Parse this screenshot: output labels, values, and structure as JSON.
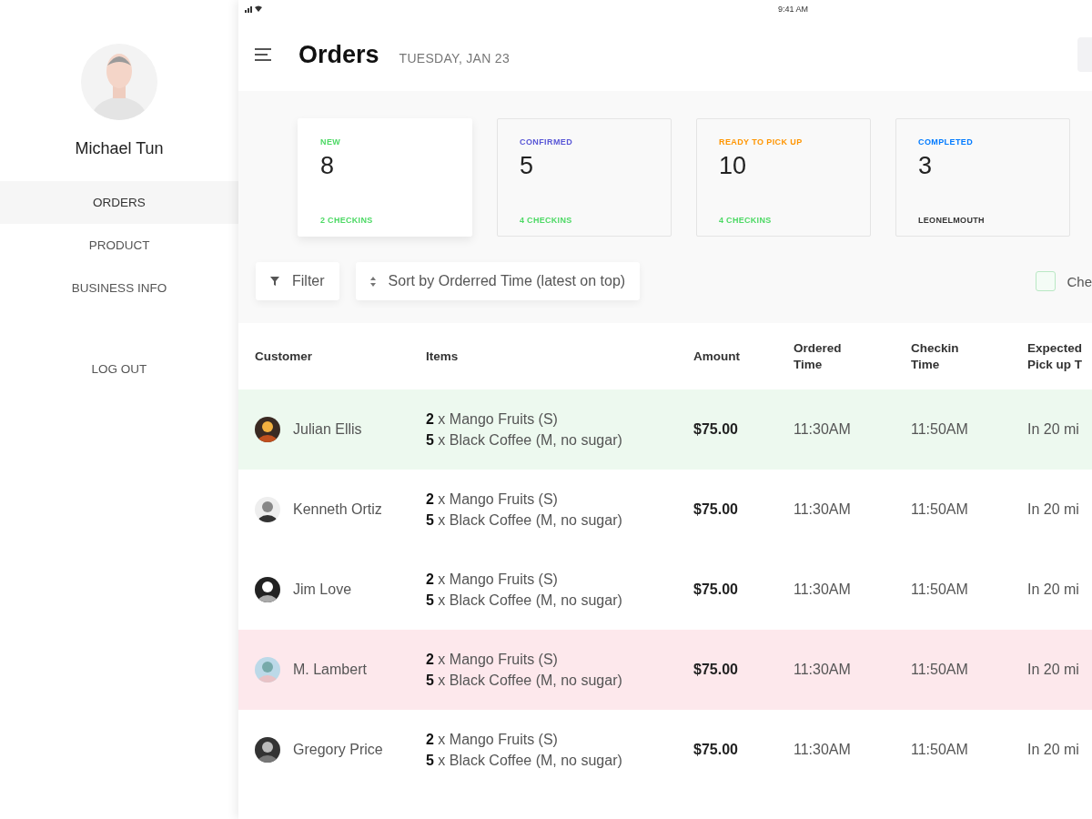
{
  "status_bar": {
    "time": "9:41 AM"
  },
  "sidebar": {
    "user_name": "Michael Tun",
    "items": [
      {
        "label": "ORDERS",
        "selected": true
      },
      {
        "label": "PRODUCT",
        "selected": false
      },
      {
        "label": "BUSINESS INFO",
        "selected": false
      }
    ],
    "logout": "LOG OUT"
  },
  "header": {
    "title": "Orders",
    "date": "TUESDAY, JAN 23"
  },
  "summary_cards": [
    {
      "label": "NEW",
      "count": "8",
      "footer": "2 CHECKINS",
      "kind": "checkins",
      "color": "#4cd964",
      "selected": true
    },
    {
      "label": "CONFIRMED",
      "count": "5",
      "footer": "4 CHECKINS",
      "kind": "checkins",
      "color": "#5856d6",
      "selected": false
    },
    {
      "label": "READY TO PICK UP",
      "count": "10",
      "footer": "4 CHECKINS",
      "kind": "checkins",
      "color": "#ff9500",
      "selected": false
    },
    {
      "label": "COMPLETED",
      "count": "3",
      "footer": "LEONELMOUTH",
      "kind": "location",
      "color": "#007aff",
      "selected": false
    }
  ],
  "toolbar": {
    "filter": "Filter",
    "sort": "Sort by Orderred Time (latest on top)",
    "checkbox": {
      "label": "Che",
      "checked": false
    }
  },
  "table": {
    "columns": [
      "Customer",
      "Items",
      "Amount",
      "Ordered Time",
      "Checkin Time",
      "Expected Pick up T"
    ],
    "rows": [
      {
        "kind": "new",
        "customer": "Julian Ellis",
        "items": [
          "**2** x Mango Fruits (S)",
          "**5** x Black Coffee (M, no sugar)"
        ],
        "amount": "$75.00",
        "ordered": "11:30AM",
        "checkin": "11:50AM",
        "expected": "In 20 mi"
      },
      {
        "kind": "plain",
        "customer": "Kenneth Ortiz",
        "items": [
          "**2** x Mango Fruits (S)",
          "**5** x Black Coffee (M, no sugar)"
        ],
        "amount": "$75.00",
        "ordered": "11:30AM",
        "checkin": "11:50AM",
        "expected": "In 20 mi"
      },
      {
        "kind": "plain",
        "customer": "Jim Love",
        "items": [
          "**2** x Mango Fruits (S)",
          "**5** x Black Coffee (M, no sugar)"
        ],
        "amount": "$75.00",
        "ordered": "11:30AM",
        "checkin": "11:50AM",
        "expected": "In 20 mi"
      },
      {
        "kind": "alert",
        "customer": "M. Lambert",
        "items": [
          "**2** x Mango Fruits (S)",
          "**5** x Black Coffee (M, no sugar)"
        ],
        "amount": "$75.00",
        "ordered": "11:30AM",
        "checkin": "11:50AM",
        "expected": "In 20 mi"
      },
      {
        "kind": "plain",
        "customer": "Gregory Price",
        "items": [
          "**2** x Mango Fruits (S)",
          "**5** x Black Coffee (M, no sugar)"
        ],
        "amount": "$75.00",
        "ordered": "11:30AM",
        "checkin": "11:50AM",
        "expected": "In 20 mi"
      }
    ]
  }
}
